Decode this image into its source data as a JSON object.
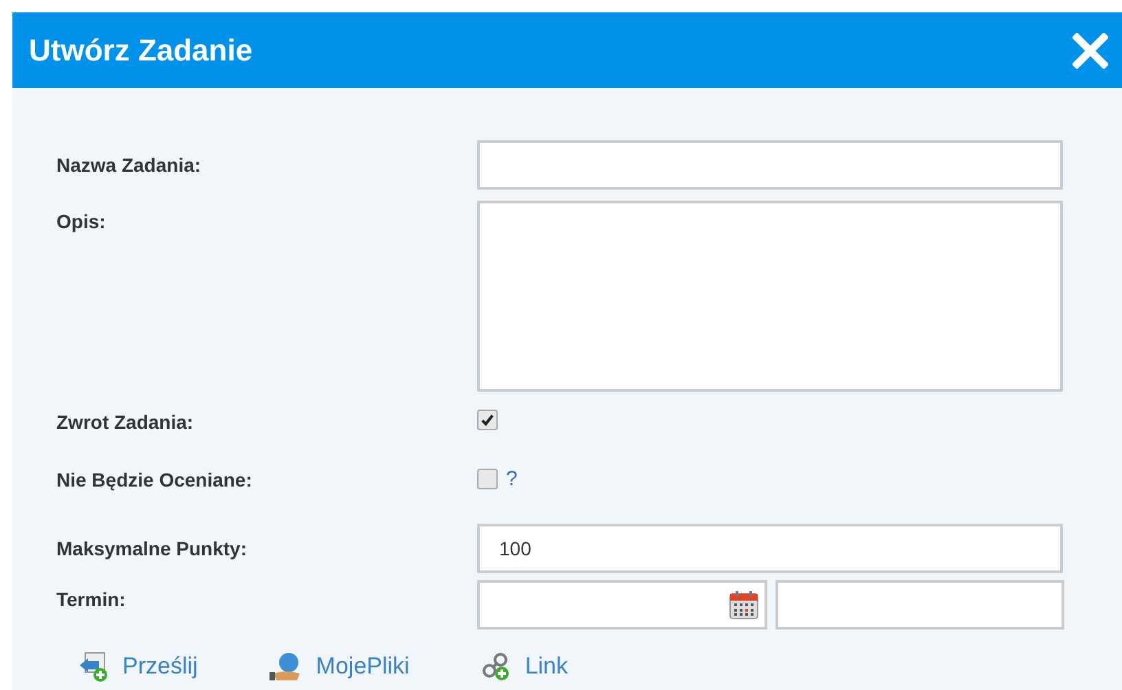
{
  "dialog": {
    "title": "Utwórz Zadanie"
  },
  "fields": [
    {
      "kind": "text",
      "label": "Nazwa Zadania:"
    },
    {
      "kind": "textarea",
      "label": "Opis:"
    },
    {
      "kind": "checkbox",
      "label": "Zwrot Zadania:",
      "checked": true
    },
    {
      "kind": "checkbox",
      "label": "Nie Będzie Oceniane:",
      "checked": false,
      "help": "?"
    },
    {
      "kind": "text",
      "label": "Maksymalne Punkty:",
      "value": "100"
    },
    {
      "kind": "date",
      "label": "Termin:"
    }
  ],
  "actions": [
    {
      "kind": "upload",
      "label": "Prześlij"
    },
    {
      "kind": "files",
      "label": "MojePliki"
    },
    {
      "kind": "link",
      "label": "Link"
    }
  ]
}
